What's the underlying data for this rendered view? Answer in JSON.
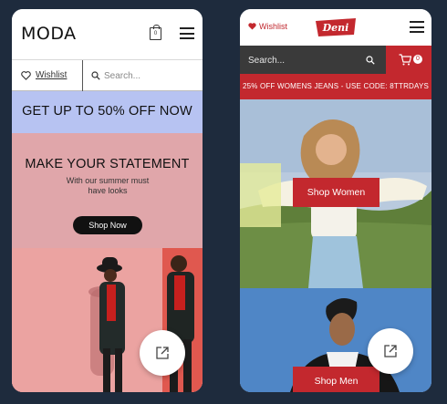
{
  "moda": {
    "logo": "MODA",
    "cart_count": "0",
    "wishlist_label": "Wishlist",
    "search_placeholder": "Search...",
    "promo": "GET UP TO 50% OFF NOW",
    "hero_title": "MAKE YOUR STATEMENT",
    "hero_subtitle_line1": "With our summer must",
    "hero_subtitle_line2": "have looks",
    "shop_button": "Shop Now",
    "share_icon": "external-link-icon"
  },
  "deni": {
    "wishlist_label": "Wishlist",
    "logo": "Deni",
    "search_placeholder": "Search...",
    "cart_count": "0",
    "promo": "25% OFF WOMENS JEANS - USE CODE: 8TTRDAYS",
    "shop_women": "Shop Women",
    "shop_men": "Shop Men",
    "share_icon": "external-link-icon"
  },
  "colors": {
    "page_bg": "#1e2b3d",
    "moda_promo_bg": "#b7c3f2",
    "moda_hero_bg": "#e0a6aa",
    "deni_red": "#c3282e",
    "deni_search_bg": "#3a3a3a"
  }
}
